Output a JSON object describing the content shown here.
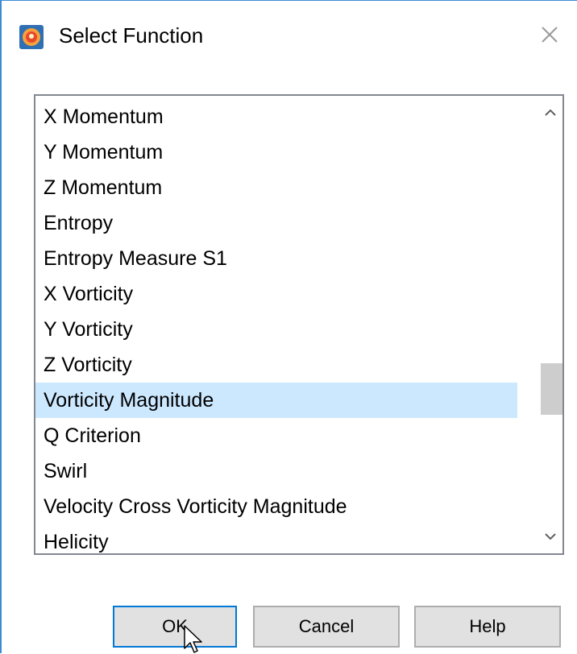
{
  "dialog": {
    "title": "Select Function",
    "app_icon": "tecplot-app-icon",
    "close_icon": "close-icon"
  },
  "list": {
    "items": [
      {
        "label": "X Momentum"
      },
      {
        "label": "Y Momentum"
      },
      {
        "label": "Z Momentum"
      },
      {
        "label": "Entropy"
      },
      {
        "label": "Entropy Measure S1"
      },
      {
        "label": "X Vorticity"
      },
      {
        "label": "Y Vorticity"
      },
      {
        "label": "Z Vorticity"
      },
      {
        "label": "Vorticity Magnitude"
      },
      {
        "label": "Q Criterion"
      },
      {
        "label": "Swirl"
      },
      {
        "label": "Velocity Cross Vorticity Magnitude"
      },
      {
        "label": "Helicity"
      }
    ],
    "selected": "Vorticity Magnitude",
    "selection_color": "#cce8ff"
  },
  "buttons": {
    "ok": "OK",
    "cancel": "Cancel",
    "help": "Help"
  },
  "colors": {
    "window_border": "#3d8ad6",
    "default_button_border": "#0078d7"
  }
}
